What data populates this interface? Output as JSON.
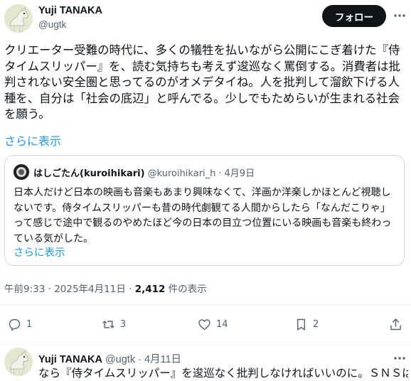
{
  "post": {
    "author": {
      "display_name": "Yuji TANAKA",
      "handle": "@ugtk",
      "avatar_icon": "dog-avatar-icon"
    },
    "follow_label": "フォロー",
    "more_icon": "more-dots-icon",
    "text": "クリエーター受難の時代に、多くの犠牲を払いながら公開にこぎ着けた『侍タイムスリッパー』を、読む気持ちも考えず逡巡なく罵倒する。消費者は批判されない安全圏と思ってるのがオメデタイね。人を批判して溜飲下げる人種を、自分は「社会の底辺」と呼んでる。少しでもためらいが生まれる社会を願う。",
    "show_more": "さらに表示",
    "quote": {
      "display_name": "はしごたん(kuroihikari)",
      "handle": "@kuroihikari_h",
      "dot": "·",
      "date": "4月9日",
      "text": "日本人だけど日本の映画も音楽もあまり興味なくて、洋画か洋楽しかほとんど視聴しないです。侍タイムスリッパーも昔の時代劇観てる人間からしたら「なんだこりゃ」って感じで途中で観るのやめたほど今の日本の目立つ位置にいる映画も音楽も終わっている気がした。",
      "show_more": "さらに表示"
    },
    "meta": {
      "time_date": "午前9:33 · 2025年4月11日 · ",
      "views_count": "2,412",
      "views_label": " 件の表示"
    },
    "actions": {
      "reply_count": "1",
      "repost_count": "3",
      "like_count": "14",
      "bookmark_count": "2"
    }
  },
  "reply_post": {
    "display_name": "Yuji TANAKA",
    "handle": "@ugtk",
    "dot": "·",
    "date": "4月11日",
    "text": "なら『侍タイムスリッパー』を逡巡なく批判しなければいいのに。ＳＮＳは"
  },
  "colors": {
    "accent": "#1d9bf0",
    "text": "#0f1419",
    "secondary": "#536471",
    "border": "#cfd9de"
  }
}
